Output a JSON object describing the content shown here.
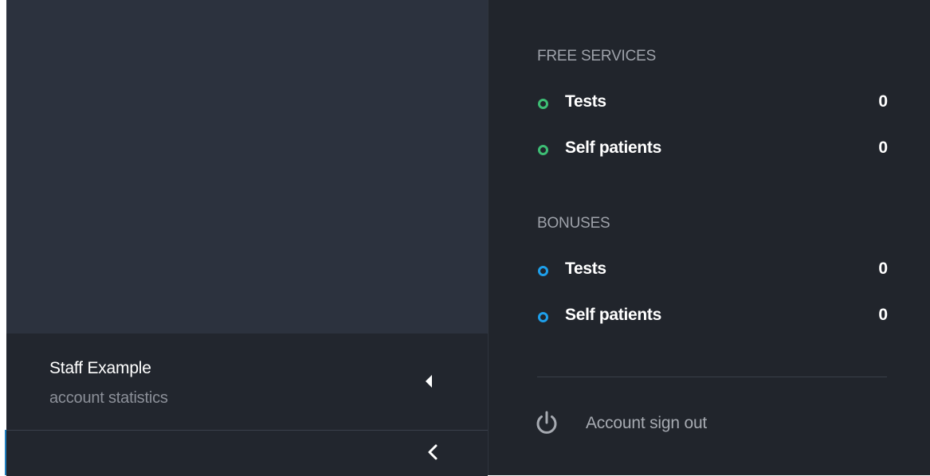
{
  "profile": {
    "name": "Staff Example",
    "subtitle": "account statistics"
  },
  "free_services": {
    "title": "FREE SERVICES",
    "dot_color": "#3dbd74",
    "items": [
      {
        "label": "Tests",
        "value": "0"
      },
      {
        "label": "Self patients",
        "value": "0"
      }
    ]
  },
  "bonuses": {
    "title": "BONUSES",
    "dot_color": "#1e9fea",
    "items": [
      {
        "label": "Tests",
        "value": "0"
      },
      {
        "label": "Self patients",
        "value": "0"
      }
    ]
  },
  "signout": {
    "label": "Account sign out",
    "icon": "power-icon"
  },
  "collapse": {
    "icon": "chevron-left-icon"
  },
  "colors": {
    "sidebar_bg": "#2c323e",
    "panel_bg": "#21252c",
    "free_accent": "#3dbd74",
    "bonus_accent": "#1e9fea"
  }
}
